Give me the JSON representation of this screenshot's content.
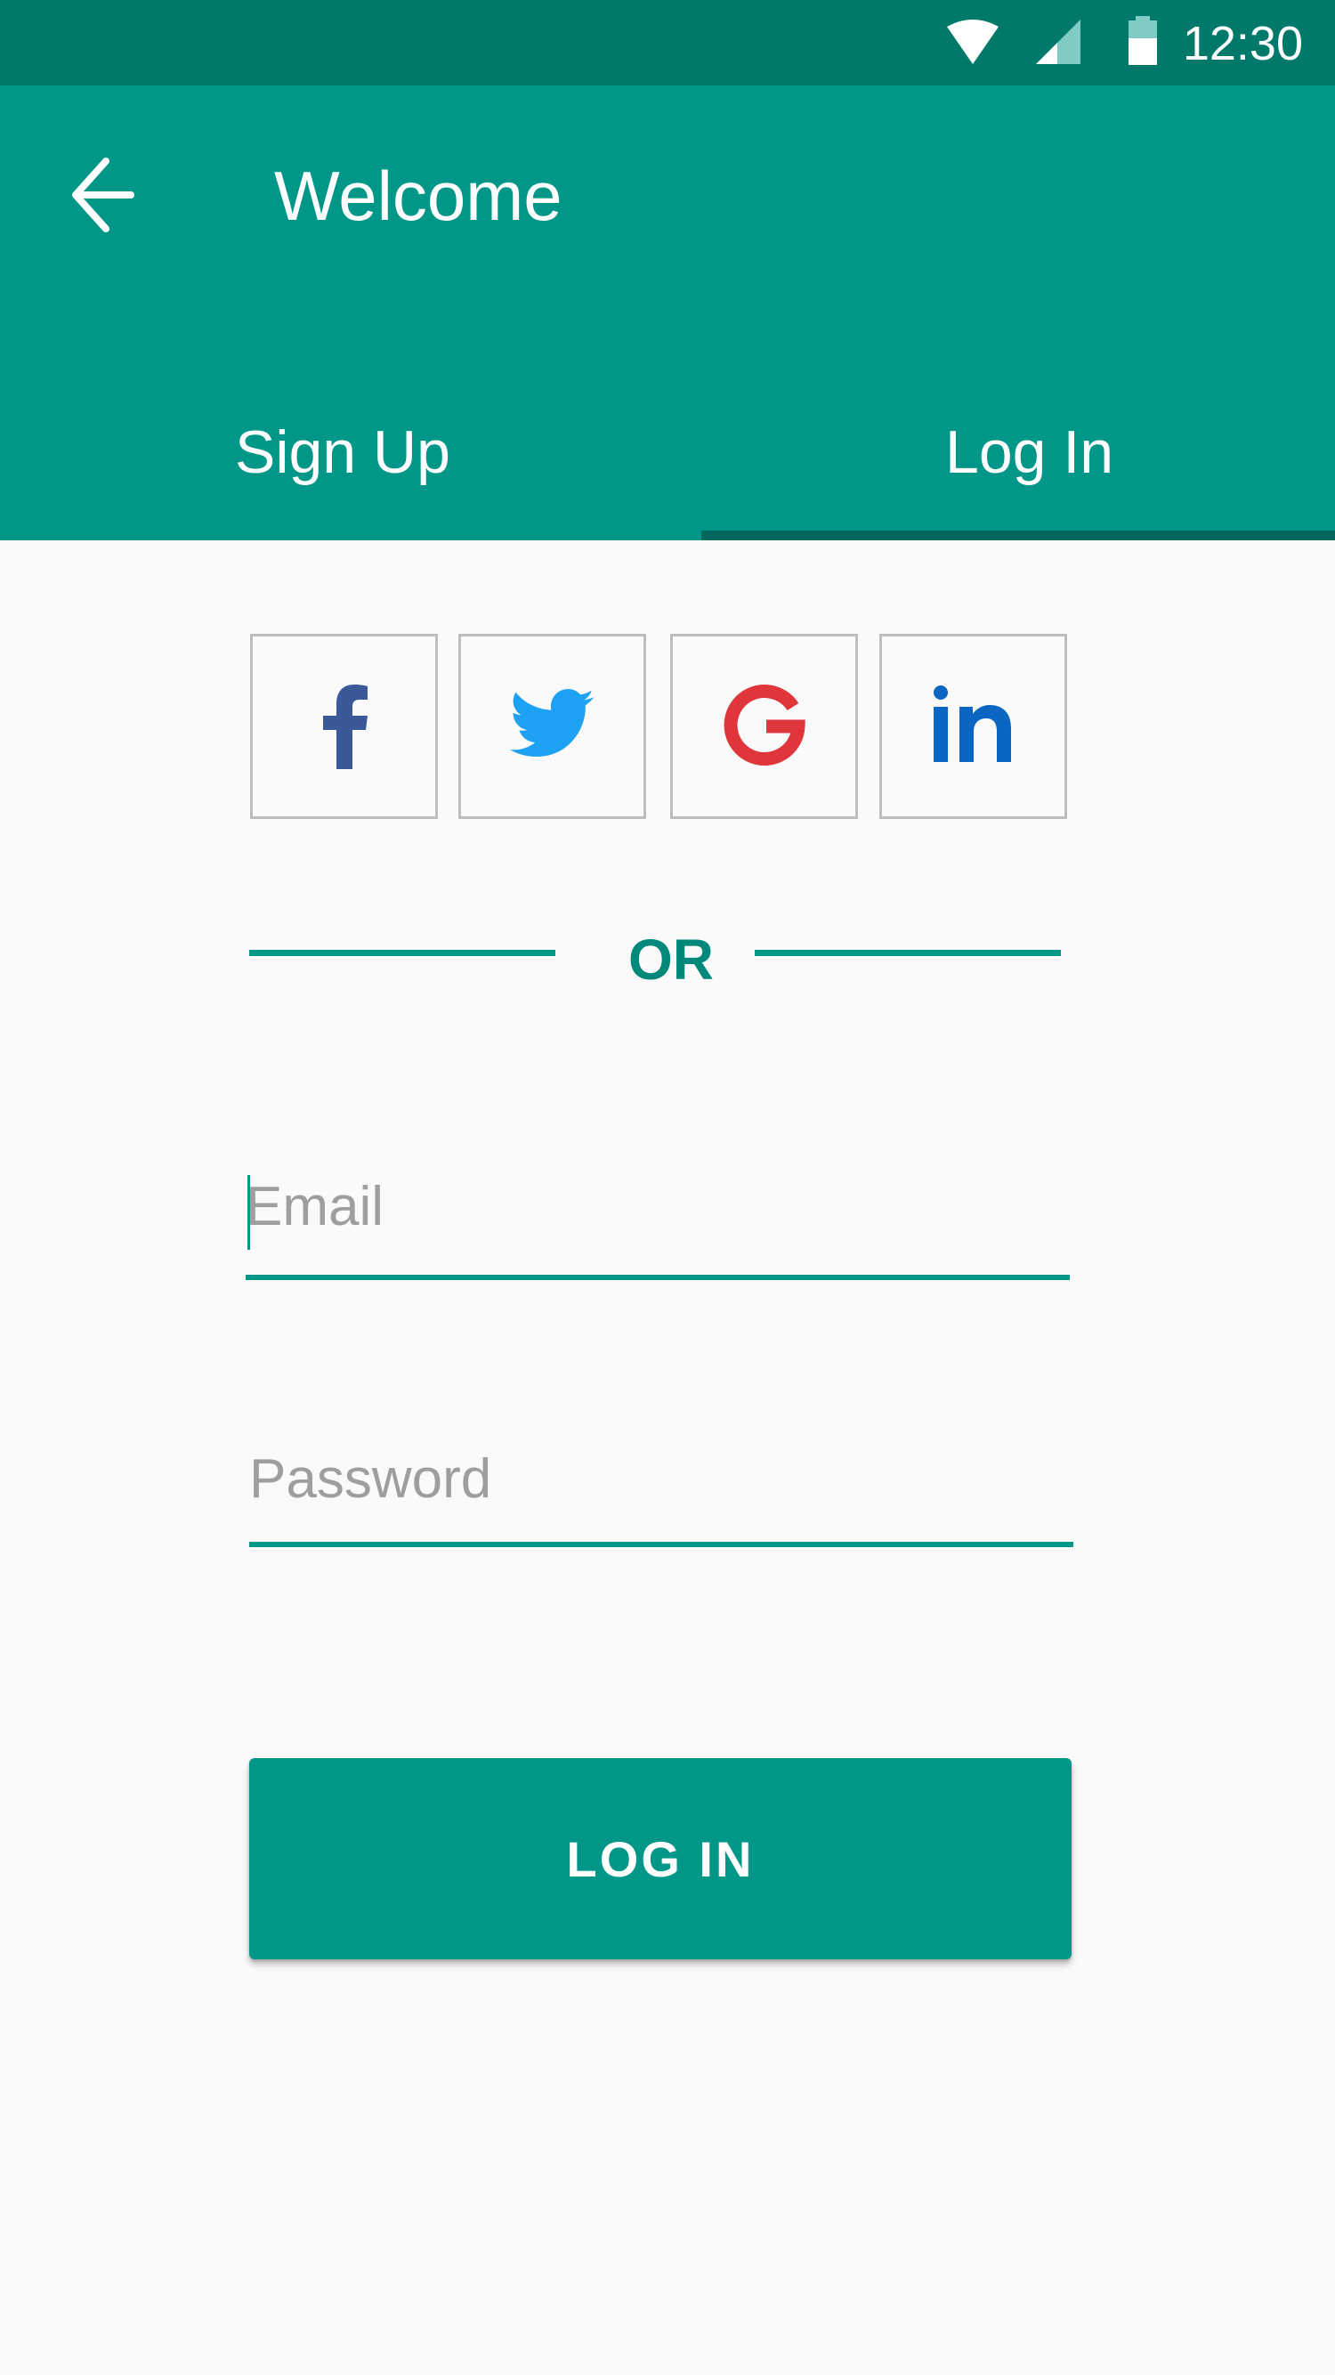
{
  "status_bar": {
    "time": "12:30",
    "icons": [
      "wifi-icon",
      "signal-icon",
      "battery-icon"
    ]
  },
  "app_bar": {
    "title": "Welcome",
    "back_icon": "arrow-back-icon"
  },
  "tabs": [
    {
      "label": "Sign Up",
      "selected": false
    },
    {
      "label": "Log In",
      "selected": true
    }
  ],
  "social_buttons": [
    {
      "name": "facebook",
      "icon": "facebook-icon",
      "color": "#3b5998"
    },
    {
      "name": "twitter",
      "icon": "twitter-icon",
      "color": "#1da1f2"
    },
    {
      "name": "google",
      "icon": "google-icon",
      "color": "#e0353b"
    },
    {
      "name": "linkedin",
      "icon": "linkedin-icon",
      "color": "#0a66c2"
    }
  ],
  "divider": {
    "label": "OR"
  },
  "form": {
    "email": {
      "placeholder": "Email",
      "value": ""
    },
    "password": {
      "placeholder": "Password",
      "value": ""
    }
  },
  "login_button": {
    "label": "LOG IN"
  },
  "colors": {
    "primary": "#009688",
    "primary_dark": "#00796b",
    "tab_indicator": "#00695c",
    "background": "#fafafa",
    "hint": "#9e9e9e",
    "border": "#bdbdbd"
  }
}
